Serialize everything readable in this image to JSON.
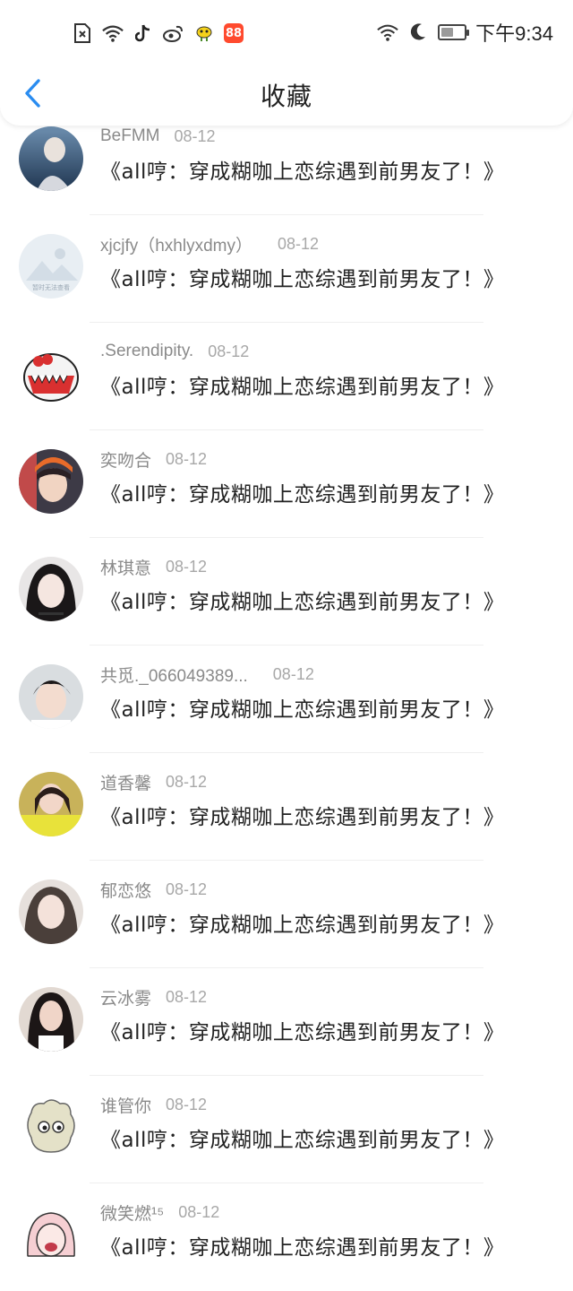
{
  "status_bar": {
    "time": "下午9:34",
    "left_icons": [
      "sim-missing-icon",
      "wifi-icon",
      "tiktok-icon",
      "weibo-icon",
      "bird-icon",
      "app-icon"
    ],
    "right_icons": [
      "wifi-icon",
      "moon-icon",
      "battery-icon"
    ]
  },
  "header": {
    "title": "收藏",
    "back_icon": "chevron-left-icon",
    "accent": "#2a8cf0"
  },
  "items": [
    {
      "name": "BeFMM",
      "date": "08-12",
      "title": "《all哼：穿成糊咖上恋综遇到前男友了！》"
    },
    {
      "name": "xjcjfy（hxhlyxdmy）",
      "date": "08-12",
      "title": "《all哼：穿成糊咖上恋综遇到前男友了！》"
    },
    {
      "name": ".Serendipity.",
      "date": "08-12",
      "title": "《all哼：穿成糊咖上恋综遇到前男友了！》"
    },
    {
      "name": "奕吻合",
      "date": "08-12",
      "title": "《all哼：穿成糊咖上恋综遇到前男友了！》"
    },
    {
      "name": "林琪意",
      "date": "08-12",
      "title": "《all哼：穿成糊咖上恋综遇到前男友了！》"
    },
    {
      "name": "共觅._066049389...",
      "date": "08-12",
      "title": "《all哼：穿成糊咖上恋综遇到前男友了！》"
    },
    {
      "name": "道香馨",
      "date": "08-12",
      "title": "《all哼：穿成糊咖上恋综遇到前男友了！》"
    },
    {
      "name": "郁恋悠",
      "date": "08-12",
      "title": "《all哼：穿成糊咖上恋综遇到前男友了！》"
    },
    {
      "name": "云冰雾",
      "date": "08-12",
      "title": "《all哼：穿成糊咖上恋综遇到前男友了！》"
    },
    {
      "name": "谁管你",
      "date": "08-12",
      "title": "《all哼：穿成糊咖上恋综遇到前男友了！》"
    },
    {
      "name": "微笑燃¹⁵",
      "date": "08-12",
      "title": "《all哼：穿成糊咖上恋综遇到前男友了！》"
    }
  ],
  "placeholder_avatar_text": "暂时无法查看"
}
